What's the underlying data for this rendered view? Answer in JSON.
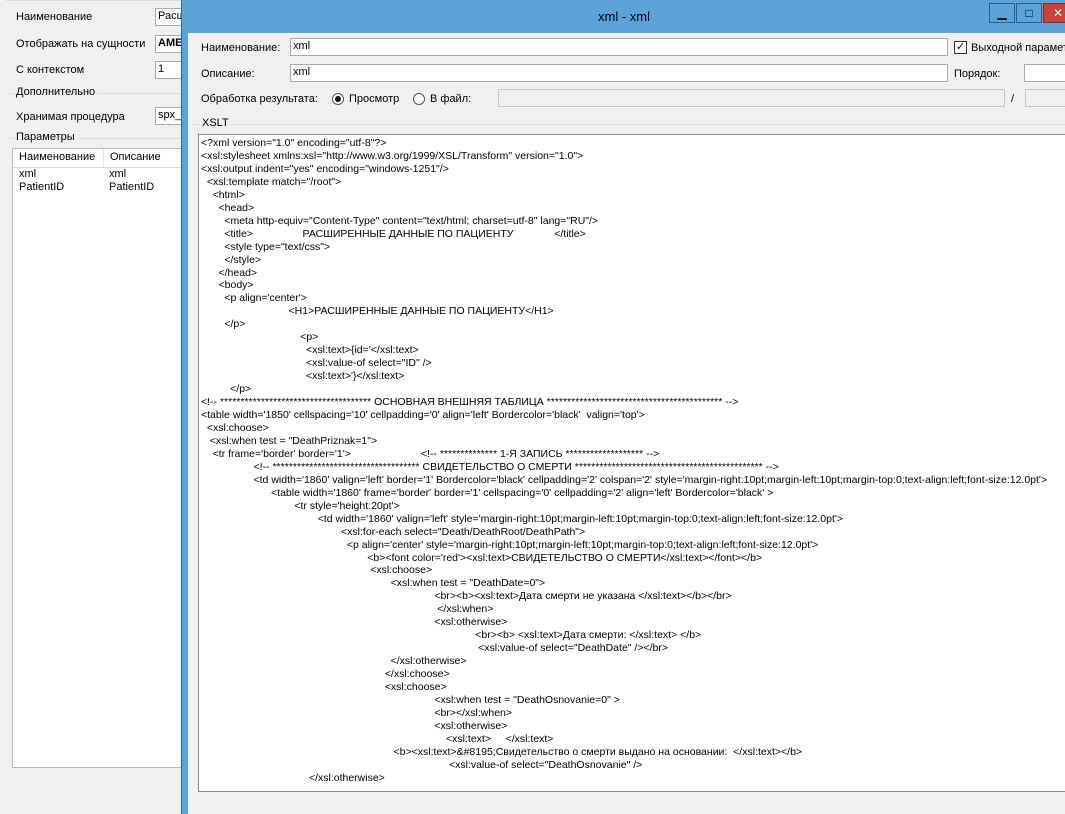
{
  "background": {
    "name_label": "Наименование",
    "name_value": "Расш",
    "entity_label": "Отображать на сущности",
    "entity_value": "AME",
    "context_label": "С контекстом",
    "context_value": "1",
    "extra_group": "Дополнительно",
    "proc_label": "Хранимая процедура",
    "proc_value": "spx_",
    "params_group": "Параметры",
    "params_headers": [
      "Наименование",
      "Описание"
    ],
    "params_rows": [
      [
        "xml",
        "xml"
      ],
      [
        "PatientID",
        "PatientID"
      ]
    ]
  },
  "dialog": {
    "title": "xml - xml",
    "minimize": "▁",
    "maximize": "□",
    "close": "✕",
    "name_label": "Наименование:",
    "name_value": "xml",
    "output_param_label": "Выходной параметр",
    "output_param_checked": true,
    "description_label": "Описание:",
    "description_value": "xml",
    "order_label": "Порядок:",
    "order_value": "",
    "processing_label": "Обработка результата:",
    "option_view": "Просмотр",
    "option_file": "В файл:",
    "file_path_value": "",
    "slash": "/",
    "xslt_group": "XSLT",
    "xslt_lines": [
      "<?xml version=\"1.0\" encoding=\"utf-8\"?>",
      "<xsl:stylesheet xmlns:xsl=\"http://www.w3.org/1999/XSL/Transform\" version=\"1.0\">",
      "<xsl:output indent=\"yes\" encoding=\"windows-1251\"/>",
      "  <xsl:template match=\"/root\">",
      "    <html>",
      "      <head>",
      "        <meta http-equiv=\"Content-Type\" content=\"text/html; charset=utf-8\" lang=\"RU\"/>",
      "        <title>                 РАСШИРЕННЫЕ ДАННЫЕ ПО ПАЦИЕНТУ              </title>",
      "        <style type=\"text/css\">",
      "        </style>",
      "      </head>",
      "      <body>",
      "        <p align='center'>",
      "                              <H1>РАСШИРЕННЫЕ ДАННЫЕ ПО ПАЦИЕНТУ</H1>",
      "        </p>",
      "                                  <p>",
      "                                    <xsl:text>{id='</xsl:text>",
      "                                    <xsl:value-of select=\"ID\" />",
      "                                    <xsl:text>'}</xsl:text>",
      "          </p>",
      "<!-- ************************************* ОСНОВНАЯ ВНЕШНЯЯ ТАБЛИЦА ******************************************* -->",
      "<table width='1850' cellspacing='10' cellpadding='0' align='left' Bordercolor='black'  valign='top'>",
      "  <xsl:choose>",
      "   <xsl:when test = \"DeathPriznak=1\">",
      "    <tr frame='border' border='1'>                        <!-- ************** 1-Я ЗАПИСЬ ******************* -->",
      "                  <!-- ************************************ СВИДЕТЕЛЬСТВО О СМЕРТИ ********************************************** -->",
      "                  <td width='1860' valign='left' border='1' Bordercolor='black' cellpadding='2' colspan='2' style='margin-right:10pt;margin-left:10pt;margin-top:0;text-align:left;font-size:12.0pt'>",
      "                        <table width='1860' frame='border' border='1' cellspacing='0' cellpadding='2' align='left' Bordercolor='black' >",
      "                                <tr style='height:20pt'>",
      "                                        <td width='1860' valign='left' style='margin-right:10pt;margin-left:10pt;margin-top:0;text-align:left;font-size:12.0pt'>",
      "                                                <xsl:for-each select=\"Death/DeathRoot/DeathPath\">",
      "                                                  <p align='center' style='margin-right:10pt;margin-left:10pt;margin-top:0;text-align:left;font-size:12.0pt'>",
      "                                                         <b><font color='red'><xsl:text>СВИДЕТЕЛЬСТВО О СМЕРТИ</xsl:text></font></b>",
      "                                                          <xsl:choose>",
      "                                                                 <xsl:when test = \"DeathDate=0\">",
      "                                                                                <br><b><xsl:text>Дата смерти не указана </xsl:text></b></br>",
      "                                                                                 </xsl:when>",
      "                                                                                <xsl:otherwise>",
      "                                                                                              <br><b> <xsl:text>Дата смерти: </xsl:text> </b>",
      "                                                                                               <xsl:value-of select=\"DeathDate\" /></br>",
      "                                                                 </xsl:otherwise>",
      "                                                               </xsl:choose>",
      "                                                               <xsl:choose>",
      "                                                                                <xsl:when test = \"DeathOsnovanie=0\" >",
      "                                                                                <br></xsl:when>",
      "                                                                                <xsl:otherwise>",
      "                                                                                    <xsl:text>     </xsl:text>",
      "                                                                  <b><xsl:text>&#8195;Свидетельство о смерти выдано на основании:  </xsl:text></b>",
      "                                                                                     <xsl:value-of select=\"DeathOsnovanie\" />",
      "                                     </xsl:otherwise>"
    ]
  }
}
